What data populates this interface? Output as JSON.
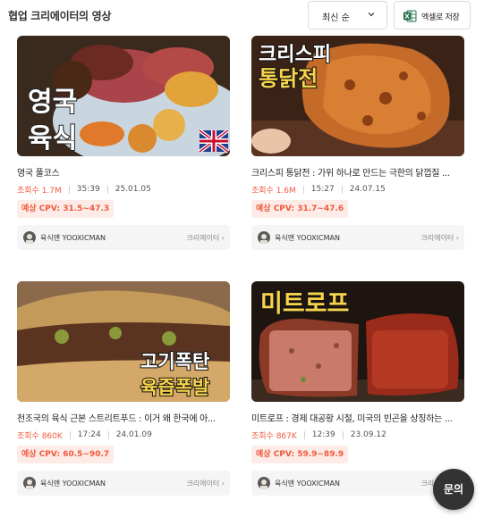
{
  "header": {
    "title": "협업 크리에이터의 영상",
    "sort_label": "최신 순",
    "excel_label": "엑셀로 저장"
  },
  "colors": {
    "accent": "#ef5a3c",
    "badge_bg": "#fdebe7",
    "excel_green": "#1e7145"
  },
  "icons": [
    "chevron-down-icon",
    "excel-icon",
    "chevron-right-icon"
  ],
  "cards": [
    {
      "thumb_text": [
        "영국",
        "육식"
      ],
      "title": "영국 풀코스",
      "views": "조회수 1.7M",
      "duration": "35:39",
      "date": "25.01.05",
      "cpv": "예상 CPV: 31.5~47.3",
      "creator": "육식맨 YOOXICMAN",
      "creator_link": "크리에이터"
    },
    {
      "thumb_text": [
        "크리스피",
        "통닭전"
      ],
      "title": "크리스피 통닭전 : 가위 하나로 만드는 극한의 닭껍질 ...",
      "views": "조회수 1.6M",
      "duration": "15:27",
      "date": "24.07.15",
      "cpv": "예상 CPV: 31.7~47.6",
      "creator": "육식맨 YOOXICMAN",
      "creator_link": "크리에이터"
    },
    {
      "thumb_text": [
        "고기폭탄",
        "육즙폭발"
      ],
      "title": "천조국의 육식 근본 스트리트푸드 : 이거 왜 한국에 아...",
      "views": "조회수 860K",
      "duration": "17:24",
      "date": "24.01.09",
      "cpv": "예상 CPV: 60.5~90.7",
      "creator": "육식맨 YOOXICMAN",
      "creator_link": "크리에이터"
    },
    {
      "thumb_text": [
        "미트로프"
      ],
      "title": "미트로프 : 경제 대공황 시절, 미국의 빈곤을 상징하는 ...",
      "views": "조회수 867K",
      "duration": "12:39",
      "date": "23.09.12",
      "cpv": "예상 CPV: 59.9~89.9",
      "creator": "육식맨 YOOXICMAN",
      "creator_link": "크리에이터"
    }
  ],
  "chat": {
    "label": "문의"
  }
}
